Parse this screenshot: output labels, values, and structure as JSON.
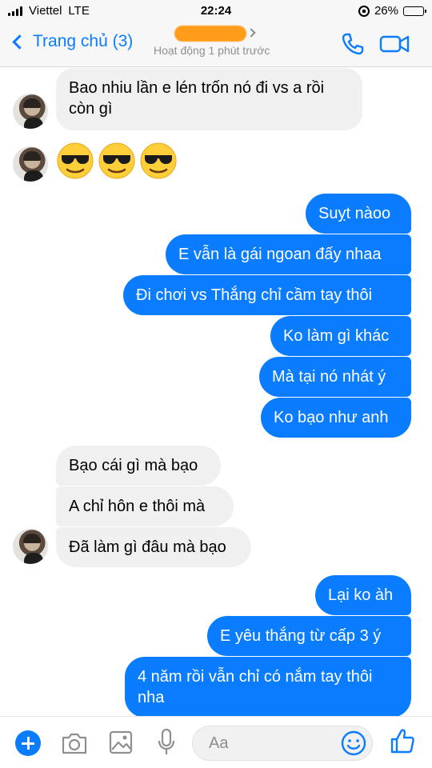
{
  "status_bar": {
    "carrier": "Viettel",
    "network": "LTE",
    "time": "22:24",
    "battery": "26%",
    "battery_level": 0.26
  },
  "header": {
    "back_label": "Trang chủ (3)",
    "active_status": "Hoạt động 1 phút trước",
    "accent_color": "#0a7cff",
    "icons": [
      "chevron-left-icon",
      "phone-icon",
      "video-camera-icon"
    ]
  },
  "messages": [
    {
      "side": "in",
      "text": "Bao nhiu lần e lén trốn nó đi vs a rồi còn gì"
    },
    {
      "side": "in",
      "text": "😎😎😎",
      "kind": "emoji"
    },
    {
      "side": "out",
      "text": "Suỵt nàoo"
    },
    {
      "side": "out",
      "text": "E vẫn là gái ngoan đấy nhaa"
    },
    {
      "side": "out",
      "text": "Đi chơi vs Thắng chỉ cầm tay thôi"
    },
    {
      "side": "out",
      "text": "Ko làm gì khác"
    },
    {
      "side": "out",
      "text": "Mà tại nó nhát ý"
    },
    {
      "side": "out",
      "text": "Ko bạo như anh"
    },
    {
      "side": "in",
      "text": "Bạo cái gì mà bạo"
    },
    {
      "side": "in",
      "text": "A chỉ hôn e thôi mà"
    },
    {
      "side": "in",
      "text": "Đã làm gì đâu mà bạo"
    },
    {
      "side": "out",
      "text": "Lại ko àh"
    },
    {
      "side": "out",
      "text": "E yêu thắng từ cấp 3 ý"
    },
    {
      "side": "out",
      "text": "4 năm rồi vẫn chỉ có nắm tay thôi nha"
    }
  ],
  "composer": {
    "placeholder": "Aa",
    "icons": [
      "plus-icon",
      "camera-icon",
      "image-icon",
      "microphone-icon",
      "smiley-icon",
      "thumbs-up-icon"
    ]
  },
  "colors": {
    "outgoing_bubble": "#0a7cff",
    "incoming_bubble": "#f1f0f0"
  }
}
